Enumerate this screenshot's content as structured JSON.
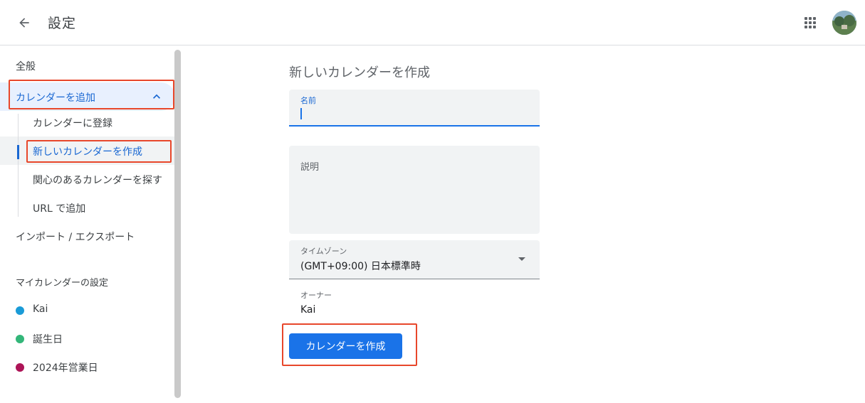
{
  "header": {
    "title": "設定"
  },
  "sidebar": {
    "general": "全般",
    "add_calendar": "カレンダーを追加",
    "sub_items": [
      "カレンダーに登録",
      "新しいカレンダーを作成",
      "関心のあるカレンダーを探す",
      "URL で追加"
    ],
    "import_export": "インポート / エクスポート",
    "my_calendars_heading": "マイカレンダーの設定",
    "calendars": [
      {
        "name": "Kai",
        "color": "#1a9bd7"
      },
      {
        "name": "誕生日",
        "color": "#33b679"
      },
      {
        "name": "2024年営業日",
        "color": "#ad1457"
      }
    ]
  },
  "main": {
    "title": "新しいカレンダーを作成",
    "name_label": "名前",
    "name_value": "",
    "description_label": "説明",
    "timezone_label": "タイムゾーン",
    "timezone_value": "(GMT+09:00) 日本標準時",
    "owner_label": "オーナー",
    "owner_value": "Kai",
    "create_button": "カレンダーを作成"
  },
  "colors": {
    "accent": "#1a73e8",
    "highlight": "#e8472b"
  }
}
